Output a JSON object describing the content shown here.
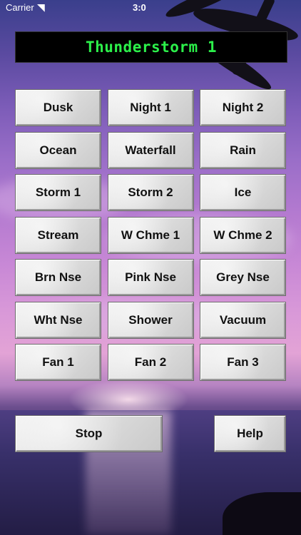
{
  "status_bar": {
    "carrier": "Carrier",
    "time": "3:0",
    "wifi_icon": "wifi-icon"
  },
  "title": "Thunderstorm 1",
  "sounds": [
    "Dusk",
    "Night 1",
    "Night 2",
    "Ocean",
    "Waterfall",
    "Rain",
    "Storm 1",
    "Storm 2",
    "Ice",
    "Stream",
    "W Chme 1",
    "W Chme 2",
    "Brn Nse",
    "Pink Nse",
    "Grey Nse",
    "Wht Nse",
    "Shower",
    "Vacuum",
    "Fan 1",
    "Fan 2",
    "Fan 3"
  ],
  "controls": {
    "stop_label": "Stop",
    "help_label": "Help"
  },
  "colors": {
    "title_text": "#2cf04a",
    "title_bg": "#000000"
  }
}
